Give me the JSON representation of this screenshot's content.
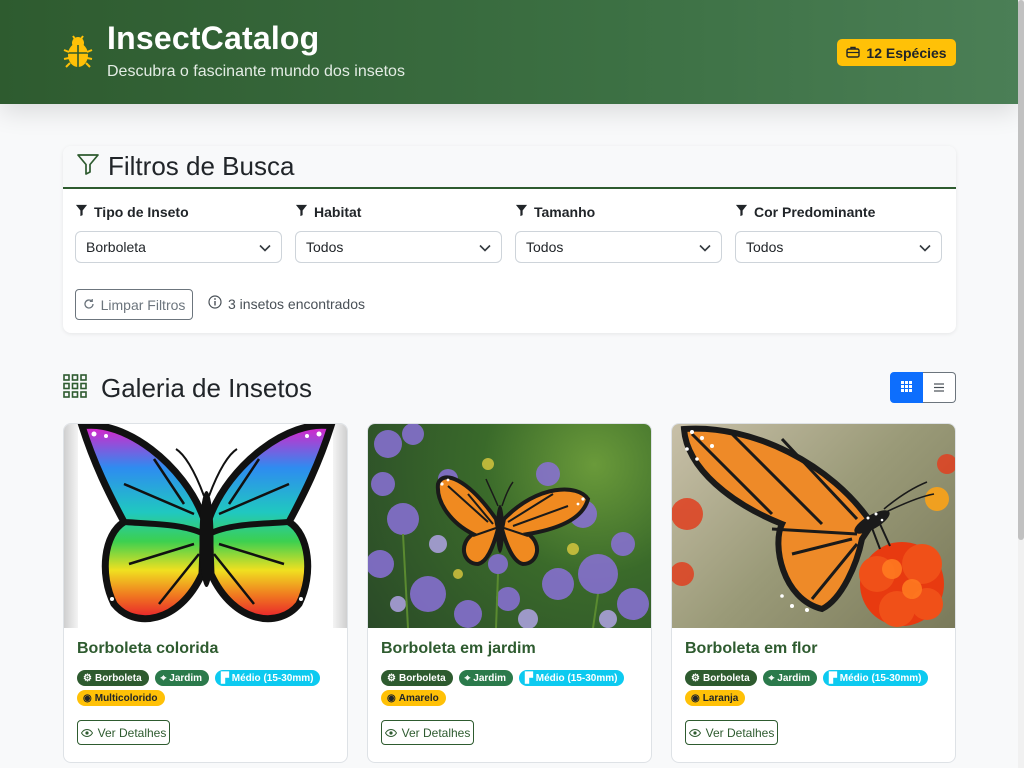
{
  "header": {
    "title": "InsectCatalog",
    "subtitle": "Descubra o fascinante mundo dos insetos",
    "species_badge": "12 Espécies",
    "logo_icon": "bug-icon"
  },
  "filters": {
    "title": "Filtros de Busca",
    "groups": [
      {
        "label": "Tipo de Inseto",
        "value": "Borboleta"
      },
      {
        "label": "Habitat",
        "value": "Todos"
      },
      {
        "label": "Tamanho",
        "value": "Todos"
      },
      {
        "label": "Cor Predominante",
        "value": "Todos"
      }
    ],
    "clear_label": "Limpar Filtros",
    "result_text": "3 insetos encontrados"
  },
  "gallery": {
    "title": "Galeria de Insetos",
    "view_active": "grid",
    "cards": [
      {
        "title": "Borboleta colorida",
        "tags": [
          "Borboleta",
          "Jardim",
          "Médio (15-30mm)",
          "Multicolorido"
        ],
        "button": "Ver Detalhes"
      },
      {
        "title": "Borboleta em jardim",
        "tags": [
          "Borboleta",
          "Jardim",
          "Médio (15-30mm)",
          "Amarelo"
        ],
        "button": "Ver Detalhes"
      },
      {
        "title": "Borboleta em flor",
        "tags": [
          "Borboleta",
          "Jardim",
          "Médio (15-30mm)",
          "Laranja"
        ],
        "button": "Ver Detalhes"
      }
    ]
  },
  "colors": {
    "header_green": "#2e5b2f",
    "accent_yellow": "#ffc107",
    "primary_blue": "#0d6efd",
    "info_cyan": "#0dcaf0"
  }
}
